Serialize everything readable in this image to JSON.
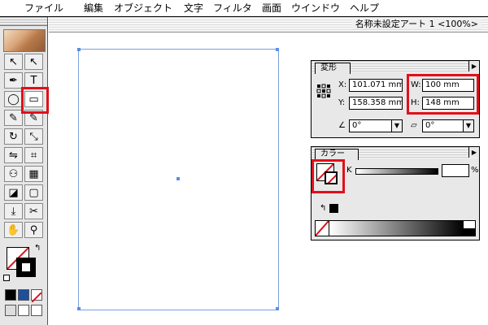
{
  "menubar": {
    "apple_icon": "apple-menu-icon",
    "items": [
      "ファイル",
      "編集",
      "オブジェクト",
      "文字",
      "フィルタ",
      "画面",
      "ウインドウ",
      "ヘルプ"
    ]
  },
  "document": {
    "title": "名称未設定アート 1 <100%>"
  },
  "toolbox": {
    "tools": [
      {
        "icon": "↖"
      },
      {
        "icon": "↖"
      },
      {
        "icon": "✒"
      },
      {
        "icon": "T"
      },
      {
        "icon": "◯"
      },
      {
        "icon": "▭"
      },
      {
        "icon": "✎"
      },
      {
        "icon": "✎"
      },
      {
        "icon": "↻"
      },
      {
        "icon": "⤡"
      },
      {
        "icon": "⇋"
      },
      {
        "icon": "⌗"
      },
      {
        "icon": "⚇"
      },
      {
        "icon": "▦"
      },
      {
        "icon": "◪"
      },
      {
        "icon": "▢"
      },
      {
        "icon": "⤓"
      },
      {
        "icon": "✂"
      },
      {
        "icon": "✋"
      },
      {
        "icon": "⚲"
      }
    ]
  },
  "transform_panel": {
    "tab": "変形",
    "x_label": "X:",
    "x_value": "101.071 mm",
    "y_label": "Y:",
    "y_value": "158.358 mm",
    "w_label": "W:",
    "w_value": "100 mm",
    "h_label": "H:",
    "h_value": "148 mm",
    "rotate_value": "0°",
    "shear_value": "0°",
    "highlight_color": "#e0101a"
  },
  "color_panel": {
    "tab": "カラー",
    "k_label": "K",
    "percent": "%",
    "k_value": "",
    "ramp_colors": [
      "#ffffff",
      "#000000"
    ]
  }
}
